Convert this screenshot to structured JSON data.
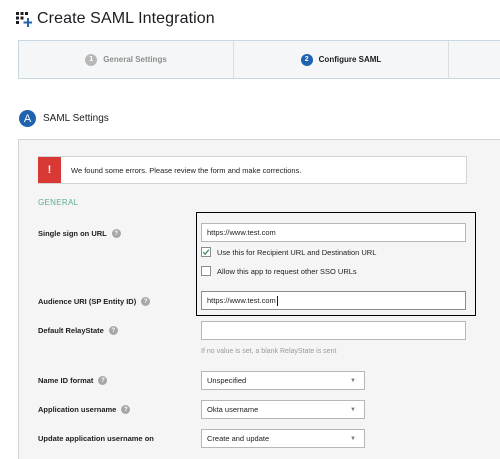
{
  "page": {
    "title": "Create SAML Integration",
    "title_icon": "app-grid-plus-icon"
  },
  "wizard": {
    "steps": [
      {
        "number": "1",
        "label": "General Settings",
        "state": "complete"
      },
      {
        "number": "2",
        "label": "Configure SAML",
        "state": "active"
      }
    ]
  },
  "section": {
    "badge": "A",
    "title": "SAML Settings"
  },
  "error": {
    "icon": "!",
    "message": "We found some errors. Please review the form and make corrections."
  },
  "general": {
    "title": "GENERAL",
    "sso_url": {
      "label": "Single sign on URL",
      "value": "https://www.test.com",
      "use_for_recipient": {
        "label": "Use this for Recipient URL and Destination URL",
        "checked": true
      },
      "allow_other_sso": {
        "label": "Allow this app to request other SSO URLs",
        "checked": false
      }
    },
    "audience_uri": {
      "label": "Audience URI (SP Entity ID)",
      "value": "https://www.test.com"
    },
    "relay_state": {
      "label": "Default RelayState",
      "value": "",
      "hint": "If no value is set, a blank RelayState is sent"
    },
    "name_id_format": {
      "label": "Name ID format",
      "selected": "Unspecified"
    },
    "app_username": {
      "label": "Application username",
      "selected": "Okta username"
    },
    "update_username": {
      "label": "Update application username on",
      "selected": "Create and update"
    }
  },
  "colors": {
    "accent": "#1f62ae",
    "error": "#d93934",
    "section_green": "#5fae8e"
  }
}
